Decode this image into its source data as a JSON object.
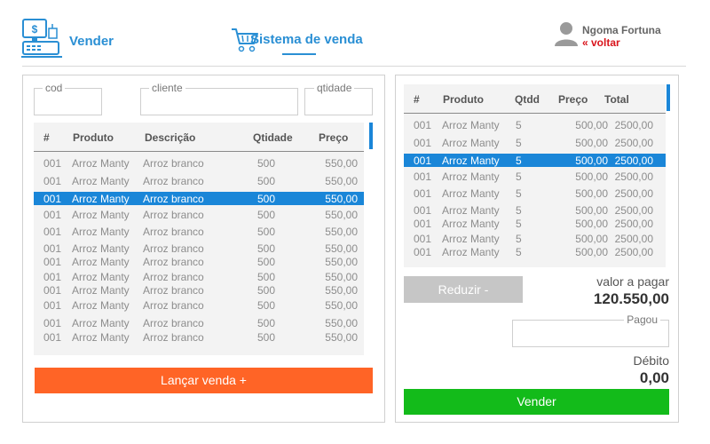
{
  "header": {
    "app_title": "Vender",
    "system_title": "Sistema de venda",
    "user_name": "Ngoma Fortuna",
    "back_link": "« voltar"
  },
  "search": {
    "cod_label": "cod",
    "cliente_label": "cliente",
    "qtidade_label": "qtidade",
    "cod_value": "",
    "cliente_value": "",
    "qtidade_value": ""
  },
  "products_table": {
    "headers": [
      "#",
      "Produto",
      "Descrição",
      "Qtidade",
      "Preço"
    ],
    "rows": [
      [
        "001",
        "Arroz Manty",
        "Arroz branco",
        "500",
        "550,00"
      ],
      [
        "001",
        "Arroz Manty",
        "Arroz branco",
        "500",
        "550,00"
      ],
      [
        "001",
        "Arroz Manty",
        "Arroz branco",
        "500",
        "550,00"
      ],
      [
        "001",
        "Arroz Manty",
        "Arroz branco",
        "500",
        "550,00"
      ],
      [
        "001",
        "Arroz Manty",
        "Arroz branco",
        "500",
        "550,00"
      ],
      [
        "001",
        "Arroz Manty",
        "Arroz branco",
        "500",
        "550,00"
      ],
      [
        "001",
        "Arroz Manty",
        "Arroz branco",
        "500",
        "550,00"
      ],
      [
        "001",
        "Arroz Manty",
        "Arroz branco",
        "500",
        "550,00"
      ],
      [
        "001",
        "Arroz Manty",
        "Arroz branco",
        "500",
        "550,00"
      ],
      [
        "001",
        "Arroz Manty",
        "Arroz branco",
        "500",
        "550,00"
      ],
      [
        "001",
        "Arroz Manty",
        "Arroz branco",
        "500",
        "550,00"
      ],
      [
        "001",
        "Arroz Manty",
        "Arroz branco",
        "500",
        "550,00"
      ]
    ],
    "selected_index": 2
  },
  "launch_button": "Lançar venda +",
  "cart_table": {
    "headers": [
      "#",
      "Produto",
      "Qtdd",
      "Preço",
      "Total"
    ],
    "rows": [
      [
        "001",
        "Arroz Manty",
        "5",
        "500,00",
        "2500,00"
      ],
      [
        "001",
        "Arroz Manty",
        "5",
        "500,00",
        "2500,00"
      ],
      [
        "001",
        "Arroz Manty",
        "5",
        "500,00",
        "2500,00"
      ],
      [
        "001",
        "Arroz Manty",
        "5",
        "500,00",
        "2500,00"
      ],
      [
        "001",
        "Arroz Manty",
        "5",
        "500,00",
        "2500,00"
      ],
      [
        "001",
        "Arroz Manty",
        "5",
        "500,00",
        "2500,00"
      ],
      [
        "001",
        "Arroz Manty",
        "5",
        "500,00",
        "2500,00"
      ],
      [
        "001",
        "Arroz Manty",
        "5",
        "500,00",
        "2500,00"
      ],
      [
        "001",
        "Arroz Manty",
        "5",
        "500,00",
        "2500,00"
      ]
    ],
    "selected_index": 2
  },
  "reduce_button": "Reduzir -",
  "payment": {
    "valor_label": "valor a pagar",
    "valor_value": "120.550,00",
    "pagou_label": "Pagou",
    "pagou_value": "",
    "debito_label": "Débito",
    "debito_value": "0,00"
  },
  "sell_button": "Vender",
  "colors": {
    "accent": "#2a8fd4",
    "selection": "#1a86d8",
    "launch": "#ff6426",
    "sell": "#13bb1a",
    "reduce": "#c6c6c6",
    "back_link": "#d9141b"
  },
  "icons": [
    "pos-register-icon",
    "shopping-cart-icon",
    "user-avatar-icon"
  ]
}
